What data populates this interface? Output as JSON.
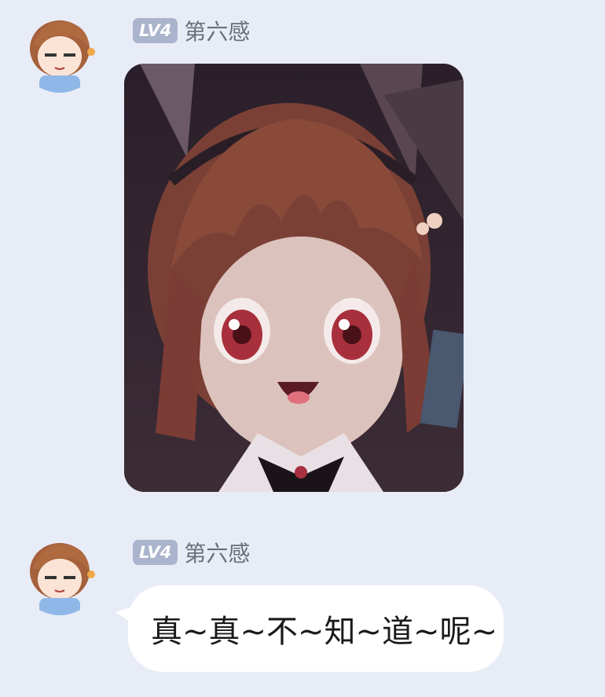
{
  "messages": [
    {
      "sender": {
        "level": "LV4",
        "name": "第六感",
        "avatar_icon": "anime-girl-avatar-icon"
      },
      "type": "image",
      "image_description_icon": "anime-girl-sticker-image"
    },
    {
      "sender": {
        "level": "LV4",
        "name": "第六感",
        "avatar_icon": "anime-girl-avatar-icon"
      },
      "type": "text",
      "text": "真~真~不~知~道~呢~"
    }
  ],
  "colors": {
    "background": "#e8ecf6",
    "level_badge": "#aab4cc",
    "sender_name": "#6b6f78",
    "bubble": "#ffffff"
  }
}
